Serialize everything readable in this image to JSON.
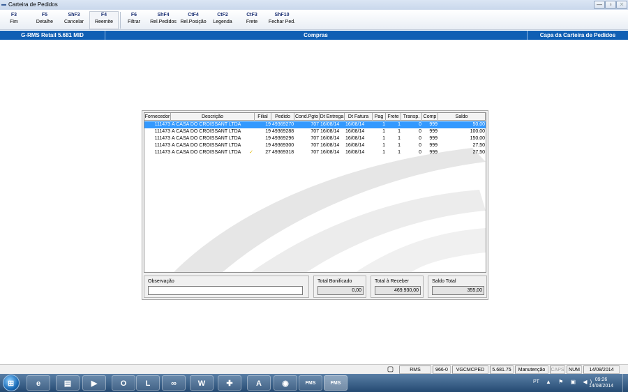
{
  "window": {
    "title": "Carteira de Pedidos",
    "app_icon": "rms-icon",
    "min_label": "—",
    "max_label": "▫",
    "close_label": "✕"
  },
  "toolbar": [
    {
      "key": "F3",
      "label": "Fim"
    },
    {
      "key": "F5",
      "label": "Detalhe"
    },
    {
      "key": "ShF3",
      "label": "Cancelar"
    },
    {
      "key": "F4",
      "label": "Reemite"
    },
    {
      "key": "F6",
      "label": "Filtrar"
    },
    {
      "key": "ShF4",
      "label": "Rel.Pedidos"
    },
    {
      "key": "CtF4",
      "label": "Rel.Posição"
    },
    {
      "key": "CtF2",
      "label": "Legenda"
    },
    {
      "key": "CtF3",
      "label": "Frete"
    },
    {
      "key": "ShF10",
      "label": "Fechar Ped."
    }
  ],
  "infobar": {
    "system": "G-RMS Retail 5.681 MID",
    "module": "Compras",
    "screen": "Capa da Carteira de Pedidos"
  },
  "grid": {
    "columns": [
      "Fornecedor",
      "Descrição",
      "Filial",
      "Pedido",
      "Cond.Pgto",
      "Dt Entrega",
      "Dt Fatura",
      "Pag",
      "Frete",
      "Transp.",
      "Comp",
      "Saldo"
    ],
    "rows": [
      {
        "fornecedor": "111473",
        "descricao": "A CASA DO CROISSANT LTDA",
        "filial": "19",
        "pedido": "49369270",
        "cond": "707",
        "entrega": "16/08/14",
        "fatura": "16/08/14",
        "pag": "1",
        "frete": "1",
        "transp": "0",
        "comp": "999",
        "saldo": "50,00",
        "mark": ""
      },
      {
        "fornecedor": "111473",
        "descricao": "A CASA DO CROISSANT LTDA",
        "filial": "19",
        "pedido": "49369288",
        "cond": "707",
        "entrega": "16/08/14",
        "fatura": "16/08/14",
        "pag": "1",
        "frete": "1",
        "transp": "0",
        "comp": "999",
        "saldo": "100,00",
        "mark": ""
      },
      {
        "fornecedor": "111473",
        "descricao": "A CASA DO CROISSANT LTDA",
        "filial": "19",
        "pedido": "49369296",
        "cond": "707",
        "entrega": "16/08/14",
        "fatura": "16/08/14",
        "pag": "1",
        "frete": "1",
        "transp": "0",
        "comp": "999",
        "saldo": "150,00",
        "mark": ""
      },
      {
        "fornecedor": "111473",
        "descricao": "A CASA DO CROISSANT LTDA",
        "filial": "19",
        "pedido": "49369300",
        "cond": "707",
        "entrega": "16/08/14",
        "fatura": "16/08/14",
        "pag": "1",
        "frete": "1",
        "transp": "0",
        "comp": "999",
        "saldo": "27,50",
        "mark": ""
      },
      {
        "fornecedor": "111473",
        "descricao": "A CASA DO CROISSANT LTDA",
        "filial": "27",
        "pedido": "49369318",
        "cond": "707",
        "entrega": "16/08/14",
        "fatura": "16/08/14",
        "pag": "1",
        "frete": "1",
        "transp": "0",
        "comp": "999",
        "saldo": "27,50",
        "mark": "✓"
      }
    ],
    "selected_row": 0
  },
  "observacao": {
    "label": "Observação",
    "value": ""
  },
  "totals": {
    "bonificado_label": "Total Bonificado",
    "bonificado_value": "0,00",
    "receber_label": "Total à Receber",
    "receber_value": "469.930,00",
    "saldo_label": "Saldo Total",
    "saldo_value": "355,00"
  },
  "statusbar": {
    "items": [
      "RMS",
      "966-0",
      "VGCMCPED",
      "5.681.75",
      "Manutenção",
      "CAPS",
      "NUM",
      "14/08/2014"
    ],
    "icon": "document-icon"
  },
  "taskbar": {
    "apps": [
      {
        "name": "ie-icon",
        "glyph": "e"
      },
      {
        "name": "explorer-icon",
        "glyph": "▤"
      },
      {
        "name": "media-player-icon",
        "glyph": "▶"
      },
      {
        "name": "outlook-icon",
        "glyph": "O"
      },
      {
        "name": "lync-icon",
        "glyph": "L"
      },
      {
        "name": "communicator-icon",
        "glyph": "∞"
      },
      {
        "name": "word-icon",
        "glyph": "W"
      },
      {
        "name": "app-plus-icon",
        "glyph": "✚"
      },
      {
        "name": "acrobat-icon",
        "glyph": "A"
      },
      {
        "name": "network-icon",
        "glyph": "◉"
      },
      {
        "name": "rms-app-1",
        "glyph": "FMS"
      },
      {
        "name": "rms-app-2",
        "glyph": "FMS"
      }
    ],
    "tray_lang": "PT",
    "tray_icons": "▲ ⚑ ▣ ◀)",
    "time": "09:26",
    "date": "14/08/2014"
  },
  "colors": {
    "infobar": "#0f5fb4",
    "selection": "#3399ff",
    "toolbar_key": "#1a2f72"
  }
}
